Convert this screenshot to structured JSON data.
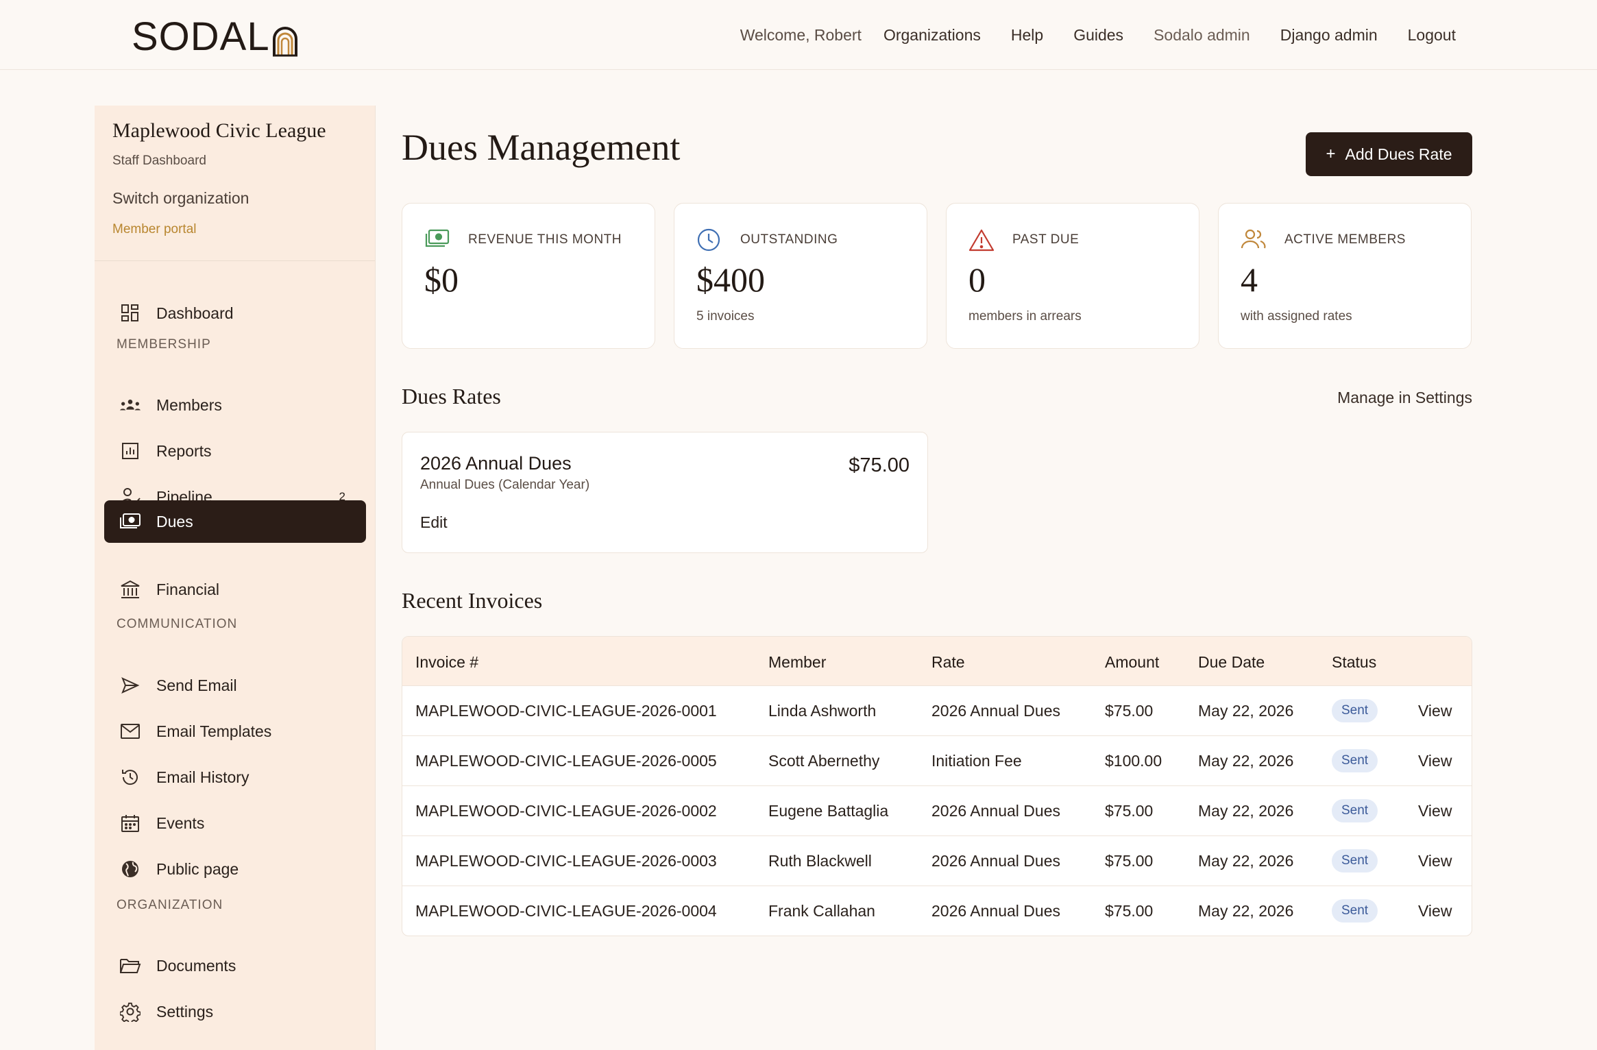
{
  "header": {
    "logo": "SODAL",
    "welcome": "Welcome, Robert",
    "nav": [
      "Organizations",
      "Help",
      "Guides",
      "Sodalo admin",
      "Django admin",
      "Logout"
    ]
  },
  "sidebar": {
    "org_name": "Maplewood Civic League",
    "org_sub": "Staff Dashboard",
    "switch_org": "Switch organization",
    "member_portal": "Member portal",
    "dashboard": "Dashboard",
    "sections": {
      "membership": "MEMBERSHIP",
      "communication": "COMMUNICATION",
      "organization": "ORGANIZATION"
    },
    "items": {
      "members": "Members",
      "reports": "Reports",
      "pipeline": "Pipeline",
      "pipeline_badge": "2",
      "dues": "Dues",
      "financial": "Financial",
      "send_email": "Send Email",
      "email_templates": "Email Templates",
      "email_history": "Email History",
      "events": "Events",
      "public_page": "Public page",
      "documents": "Documents",
      "settings": "Settings"
    }
  },
  "main": {
    "title": "Dues Management",
    "add_button": "Add Dues Rate",
    "stats": [
      {
        "label": "REVENUE THIS MONTH",
        "value": "$0",
        "sub": ""
      },
      {
        "label": "OUTSTANDING",
        "value": "$400",
        "sub": "5 invoices"
      },
      {
        "label": "PAST DUE",
        "value": "0",
        "sub": "members in arrears"
      },
      {
        "label": "ACTIVE MEMBERS",
        "value": "4",
        "sub": "with assigned rates"
      }
    ],
    "dues_rates_title": "Dues Rates",
    "manage_link": "Manage in Settings",
    "rate": {
      "name": "2026 Annual Dues",
      "type": "Annual Dues (Calendar Year)",
      "amount": "$75.00",
      "edit": "Edit"
    },
    "recent_invoices_title": "Recent Invoices",
    "invoice_columns": [
      "Invoice #",
      "Member",
      "Rate",
      "Amount",
      "Due Date",
      "Status"
    ],
    "invoices": [
      {
        "number": "MAPLEWOOD-CIVIC-LEAGUE-2026-0001",
        "member": "Linda Ashworth",
        "rate": "2026 Annual Dues",
        "amount": "$75.00",
        "due": "May 22, 2026",
        "status": "Sent",
        "action": "View"
      },
      {
        "number": "MAPLEWOOD-CIVIC-LEAGUE-2026-0005",
        "member": "Scott Abernethy",
        "rate": "Initiation Fee",
        "amount": "$100.00",
        "due": "May 22, 2026",
        "status": "Sent",
        "action": "View"
      },
      {
        "number": "MAPLEWOOD-CIVIC-LEAGUE-2026-0002",
        "member": "Eugene Battaglia",
        "rate": "2026 Annual Dues",
        "amount": "$75.00",
        "due": "May 22, 2026",
        "status": "Sent",
        "action": "View"
      },
      {
        "number": "MAPLEWOOD-CIVIC-LEAGUE-2026-0003",
        "member": "Ruth Blackwell",
        "rate": "2026 Annual Dues",
        "amount": "$75.00",
        "due": "May 22, 2026",
        "status": "Sent",
        "action": "View"
      },
      {
        "number": "MAPLEWOOD-CIVIC-LEAGUE-2026-0004",
        "member": "Frank Callahan",
        "rate": "2026 Annual Dues",
        "amount": "$75.00",
        "due": "May 22, 2026",
        "status": "Sent",
        "action": "View"
      }
    ]
  },
  "colors": {
    "accent_dark": "#2b1d17",
    "sidebar_bg": "#fbece0",
    "member_portal_gold": "#b8862f",
    "status_sent_bg": "#e4ebf7",
    "status_sent_text": "#3b5a99",
    "revenue_icon": "#4a9a5a",
    "outstanding_icon": "#3f6fb3",
    "past_due_icon": "#c23b2f",
    "members_icon": "#c0873a"
  },
  "icons": {
    "revenue": "money-icon",
    "outstanding": "clock-icon",
    "past_due": "warning-icon",
    "active_members": "users-icon"
  }
}
